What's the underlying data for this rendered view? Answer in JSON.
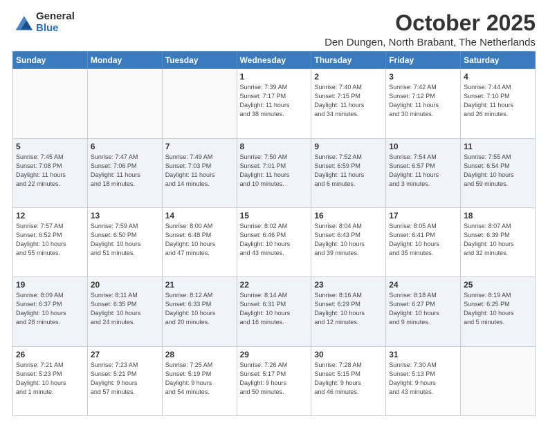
{
  "logo": {
    "general": "General",
    "blue": "Blue"
  },
  "title": "October 2025",
  "location": "Den Dungen, North Brabant, The Netherlands",
  "days_of_week": [
    "Sunday",
    "Monday",
    "Tuesday",
    "Wednesday",
    "Thursday",
    "Friday",
    "Saturday"
  ],
  "weeks": [
    {
      "shaded": false,
      "days": [
        {
          "num": "",
          "info": ""
        },
        {
          "num": "",
          "info": ""
        },
        {
          "num": "",
          "info": ""
        },
        {
          "num": "1",
          "info": "Sunrise: 7:39 AM\nSunset: 7:17 PM\nDaylight: 11 hours\nand 38 minutes."
        },
        {
          "num": "2",
          "info": "Sunrise: 7:40 AM\nSunset: 7:15 PM\nDaylight: 11 hours\nand 34 minutes."
        },
        {
          "num": "3",
          "info": "Sunrise: 7:42 AM\nSunset: 7:12 PM\nDaylight: 11 hours\nand 30 minutes."
        },
        {
          "num": "4",
          "info": "Sunrise: 7:44 AM\nSunset: 7:10 PM\nDaylight: 11 hours\nand 26 minutes."
        }
      ]
    },
    {
      "shaded": true,
      "days": [
        {
          "num": "5",
          "info": "Sunrise: 7:45 AM\nSunset: 7:08 PM\nDaylight: 11 hours\nand 22 minutes."
        },
        {
          "num": "6",
          "info": "Sunrise: 7:47 AM\nSunset: 7:06 PM\nDaylight: 11 hours\nand 18 minutes."
        },
        {
          "num": "7",
          "info": "Sunrise: 7:49 AM\nSunset: 7:03 PM\nDaylight: 11 hours\nand 14 minutes."
        },
        {
          "num": "8",
          "info": "Sunrise: 7:50 AM\nSunset: 7:01 PM\nDaylight: 11 hours\nand 10 minutes."
        },
        {
          "num": "9",
          "info": "Sunrise: 7:52 AM\nSunset: 6:59 PM\nDaylight: 11 hours\nand 6 minutes."
        },
        {
          "num": "10",
          "info": "Sunrise: 7:54 AM\nSunset: 6:57 PM\nDaylight: 11 hours\nand 3 minutes."
        },
        {
          "num": "11",
          "info": "Sunrise: 7:55 AM\nSunset: 6:54 PM\nDaylight: 10 hours\nand 59 minutes."
        }
      ]
    },
    {
      "shaded": false,
      "days": [
        {
          "num": "12",
          "info": "Sunrise: 7:57 AM\nSunset: 6:52 PM\nDaylight: 10 hours\nand 55 minutes."
        },
        {
          "num": "13",
          "info": "Sunrise: 7:59 AM\nSunset: 6:50 PM\nDaylight: 10 hours\nand 51 minutes."
        },
        {
          "num": "14",
          "info": "Sunrise: 8:00 AM\nSunset: 6:48 PM\nDaylight: 10 hours\nand 47 minutes."
        },
        {
          "num": "15",
          "info": "Sunrise: 8:02 AM\nSunset: 6:46 PM\nDaylight: 10 hours\nand 43 minutes."
        },
        {
          "num": "16",
          "info": "Sunrise: 8:04 AM\nSunset: 6:43 PM\nDaylight: 10 hours\nand 39 minutes."
        },
        {
          "num": "17",
          "info": "Sunrise: 8:05 AM\nSunset: 6:41 PM\nDaylight: 10 hours\nand 35 minutes."
        },
        {
          "num": "18",
          "info": "Sunrise: 8:07 AM\nSunset: 6:39 PM\nDaylight: 10 hours\nand 32 minutes."
        }
      ]
    },
    {
      "shaded": true,
      "days": [
        {
          "num": "19",
          "info": "Sunrise: 8:09 AM\nSunset: 6:37 PM\nDaylight: 10 hours\nand 28 minutes."
        },
        {
          "num": "20",
          "info": "Sunrise: 8:11 AM\nSunset: 6:35 PM\nDaylight: 10 hours\nand 24 minutes."
        },
        {
          "num": "21",
          "info": "Sunrise: 8:12 AM\nSunset: 6:33 PM\nDaylight: 10 hours\nand 20 minutes."
        },
        {
          "num": "22",
          "info": "Sunrise: 8:14 AM\nSunset: 6:31 PM\nDaylight: 10 hours\nand 16 minutes."
        },
        {
          "num": "23",
          "info": "Sunrise: 8:16 AM\nSunset: 6:29 PM\nDaylight: 10 hours\nand 12 minutes."
        },
        {
          "num": "24",
          "info": "Sunrise: 8:18 AM\nSunset: 6:27 PM\nDaylight: 10 hours\nand 9 minutes."
        },
        {
          "num": "25",
          "info": "Sunrise: 8:19 AM\nSunset: 6:25 PM\nDaylight: 10 hours\nand 5 minutes."
        }
      ]
    },
    {
      "shaded": false,
      "days": [
        {
          "num": "26",
          "info": "Sunrise: 7:21 AM\nSunset: 5:23 PM\nDaylight: 10 hours\nand 1 minute."
        },
        {
          "num": "27",
          "info": "Sunrise: 7:23 AM\nSunset: 5:21 PM\nDaylight: 9 hours\nand 57 minutes."
        },
        {
          "num": "28",
          "info": "Sunrise: 7:25 AM\nSunset: 5:19 PM\nDaylight: 9 hours\nand 54 minutes."
        },
        {
          "num": "29",
          "info": "Sunrise: 7:26 AM\nSunset: 5:17 PM\nDaylight: 9 hours\nand 50 minutes."
        },
        {
          "num": "30",
          "info": "Sunrise: 7:28 AM\nSunset: 5:15 PM\nDaylight: 9 hours\nand 46 minutes."
        },
        {
          "num": "31",
          "info": "Sunrise: 7:30 AM\nSunset: 5:13 PM\nDaylight: 9 hours\nand 43 minutes."
        },
        {
          "num": "",
          "info": ""
        }
      ]
    }
  ]
}
